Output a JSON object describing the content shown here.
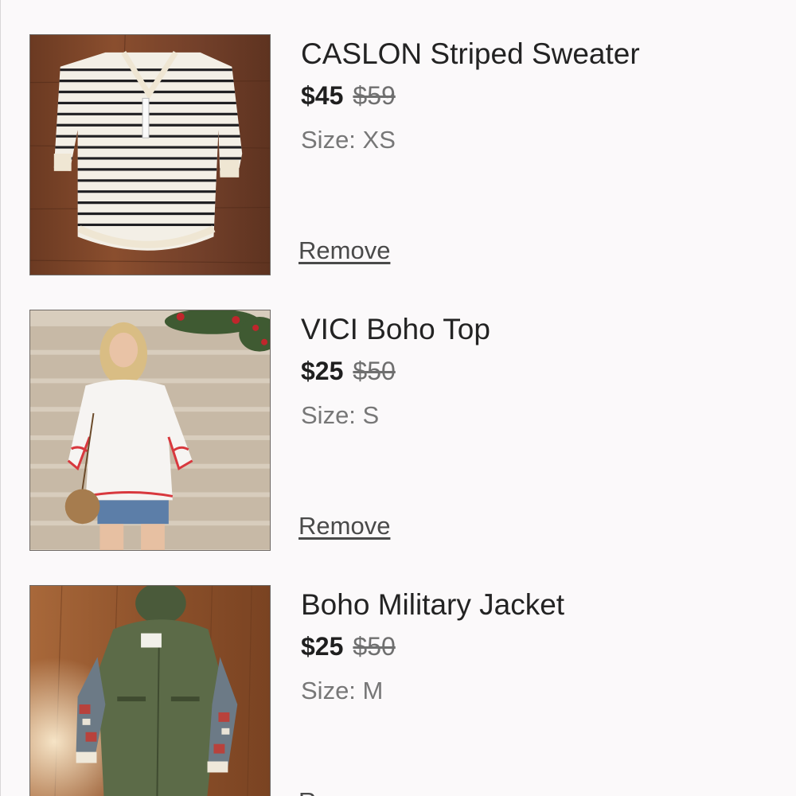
{
  "items": [
    {
      "title": "CASLON Striped Sweater",
      "price": "$45",
      "original_price": "$59",
      "size": "Size: XS",
      "remove_label": "Remove"
    },
    {
      "title": "VICI Boho Top",
      "price": "$25",
      "original_price": "$50",
      "size": "Size: S",
      "remove_label": "Remove"
    },
    {
      "title": "Boho Military Jacket",
      "price": "$25",
      "original_price": "$50",
      "size": "Size: M",
      "remove_label": "Remove"
    }
  ]
}
